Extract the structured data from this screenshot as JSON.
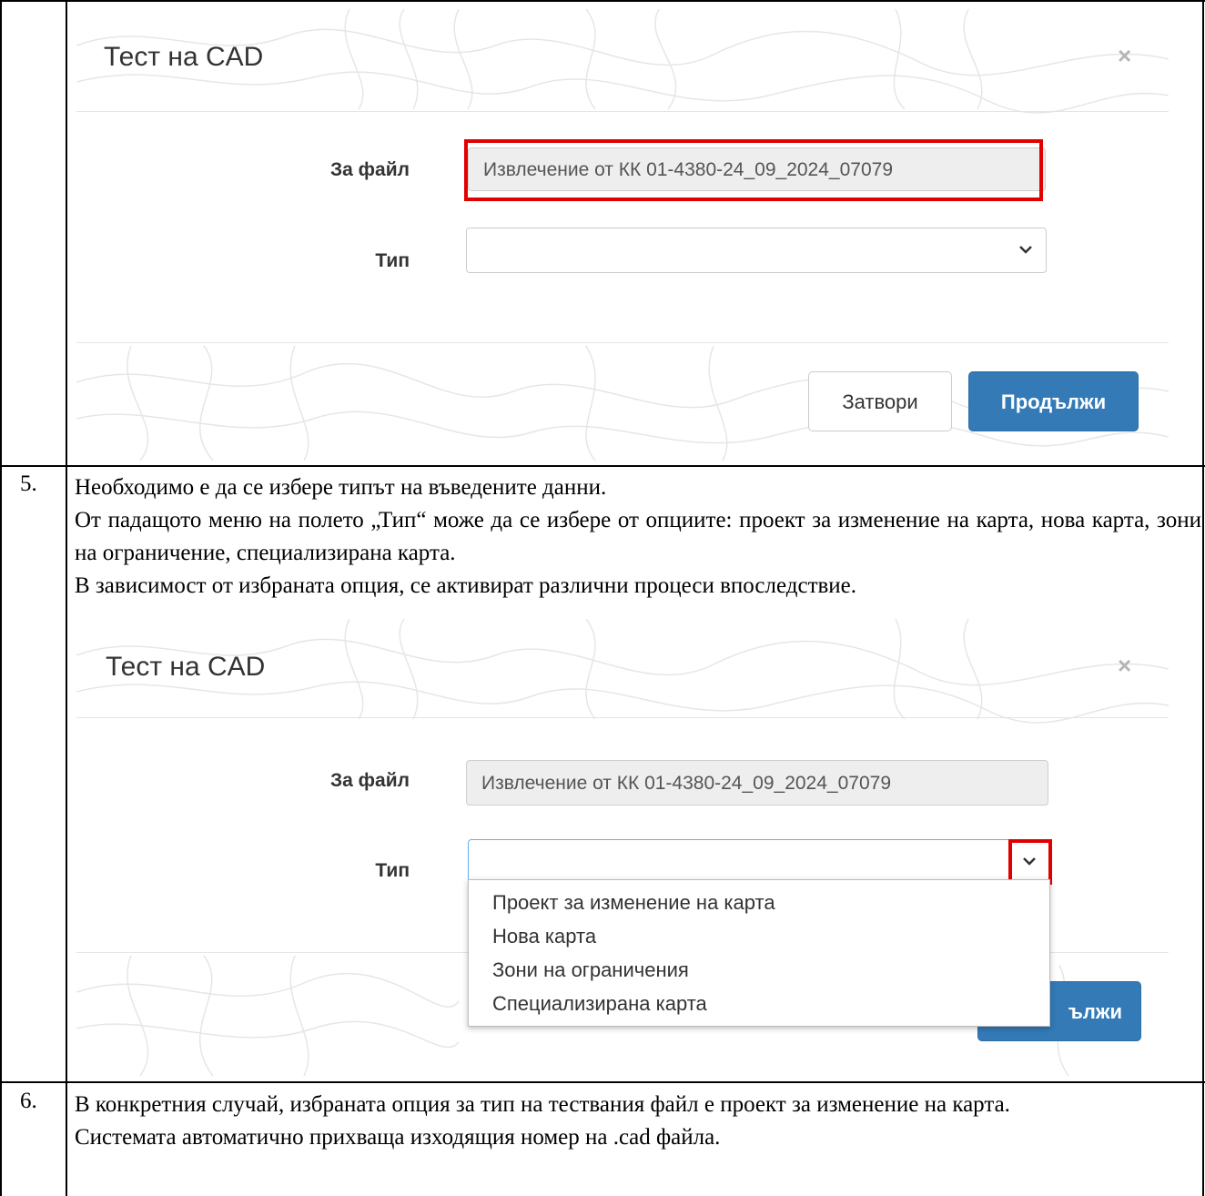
{
  "screenshot1": {
    "modal_title": "Тест на CAD",
    "close_symbol": "×",
    "file_label": "За файл",
    "file_value": "Извлечение от КК 01-4380-24_09_2024_07079",
    "type_label": "Тип",
    "type_value": "",
    "close_button": "Затвори",
    "continue_button": "Продължи"
  },
  "step5": {
    "number": "5.",
    "lines": [
      "Необходимо е да се избере типът на въведените данни.",
      "От падащото меню на полето „Тип“ може да се избере от опциите: проект за изменение на карта, нова карта, зони на ограничение, специализирана карта.",
      "В зависимост от избраната опция, се активират различни процеси впоследствие."
    ]
  },
  "screenshot2": {
    "modal_title": "Тест на CAD",
    "close_symbol": "×",
    "file_label": "За файл",
    "file_value": "Извлечение от КК 01-4380-24_09_2024_07079",
    "type_label": "Тип",
    "type_value": "",
    "options": [
      "Проект за изменение на карта",
      "Нова карта",
      "Зони на ограничения",
      "Специализирана карта"
    ],
    "continue_button_partial": "ължи"
  },
  "step6": {
    "number": "6.",
    "lines": [
      "В конкретния случай, избраната опция за тип на тествания файл е проект за изменение на карта.",
      "Системата автоматично прихваща изходящия номер на .cad файла."
    ]
  },
  "colors": {
    "highlight_red": "#e00000",
    "primary_blue": "#337ab7",
    "focus_blue": "#66afe9"
  },
  "icons": [
    "close-icon",
    "chevron-down-icon"
  ]
}
